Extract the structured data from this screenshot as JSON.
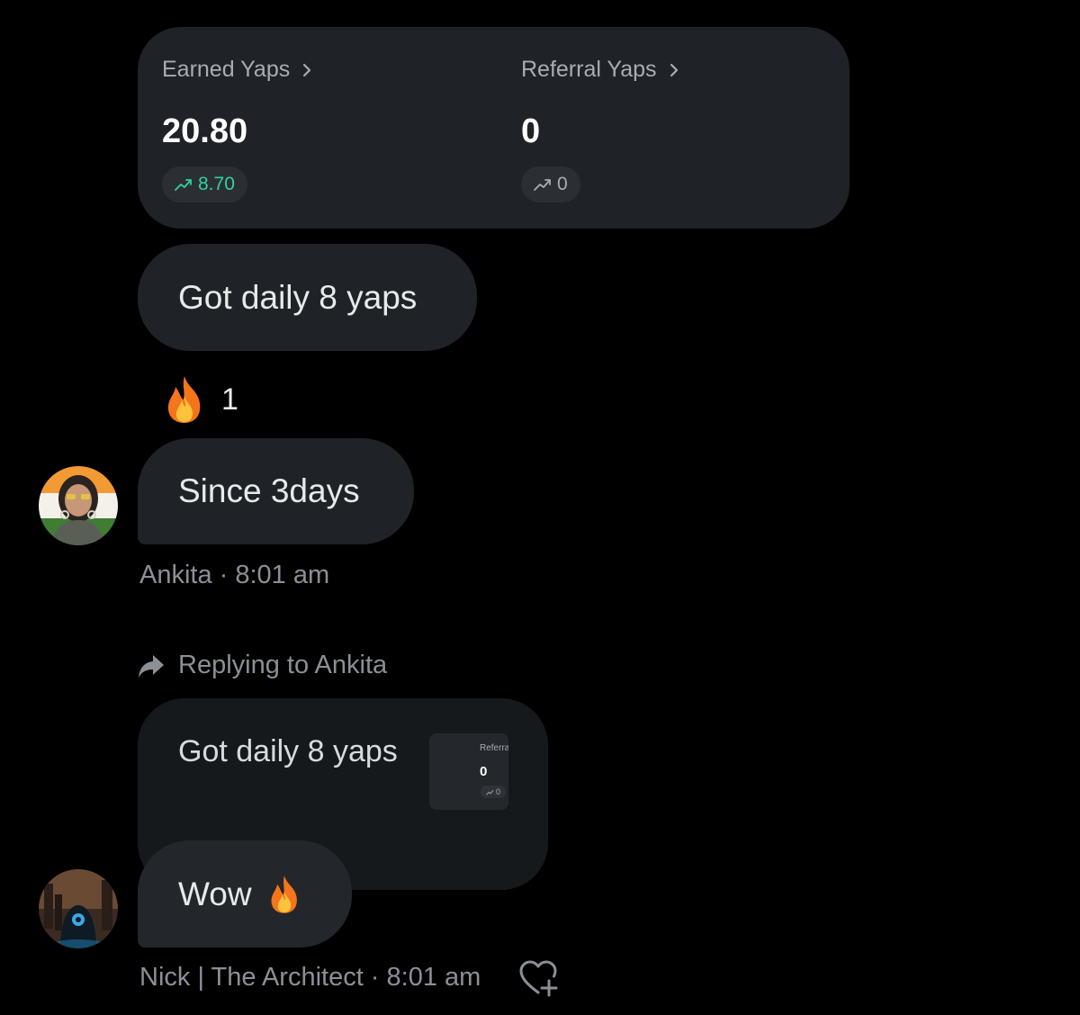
{
  "stats": {
    "earned_title": "Earned Yaps",
    "earned_value": "20.80",
    "earned_change": "8.70",
    "referral_title": "Referral Yaps",
    "referral_value": "0",
    "referral_change": "0"
  },
  "messages": [
    {
      "text": "Got daily 8 yaps",
      "reaction_emoji": "fire",
      "reaction_count": "1"
    },
    {
      "text": "Since 3days",
      "author": "Ankita",
      "time": "8:01 am",
      "meta": "Ankita · 8:01 am"
    }
  ],
  "reply": {
    "replying_to": "Replying to Ankita",
    "quoted_text": "Got daily 8 yaps",
    "thumb_title": "Referral",
    "thumb_value": "0",
    "thumb_change": "0",
    "text": "Wow",
    "emoji": "fire",
    "author": "Nick | The Architect",
    "time": "8:01 am",
    "meta": "Nick | The Architect · 8:01 am"
  },
  "icons": [
    "chevron-right-icon",
    "trend-up-icon",
    "fire-icon",
    "reply-arrow-icon",
    "heart-add-icon"
  ],
  "colors": {
    "background": "#000000",
    "bubble": "#1f2327",
    "positive": "#2fd3a0",
    "muted": "#8b9097"
  }
}
